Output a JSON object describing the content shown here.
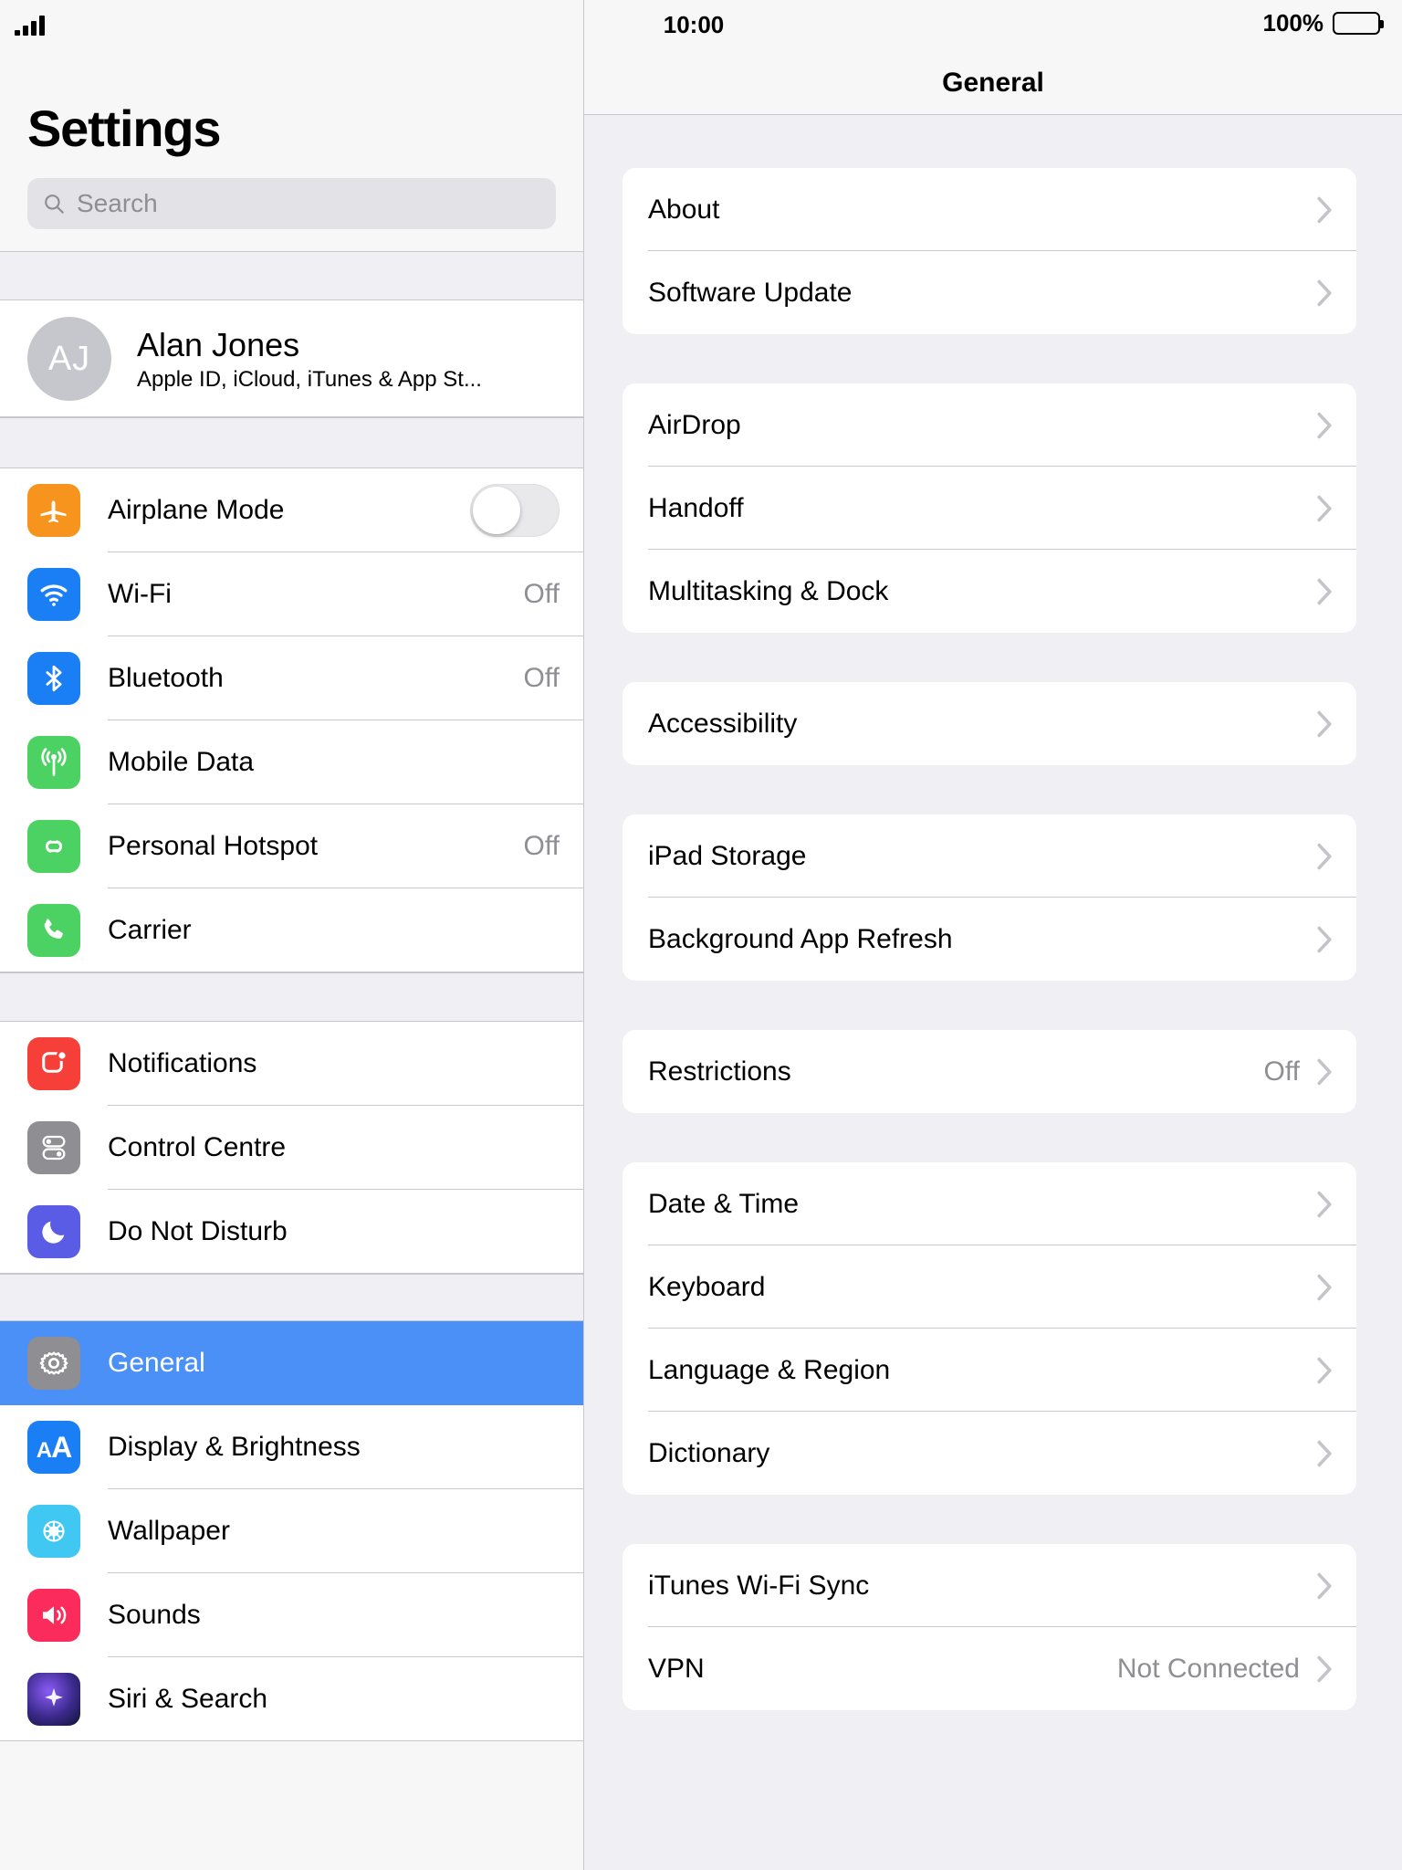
{
  "status_bar": {
    "signal_icon": "cellular-signal-icon",
    "time": "10:00",
    "battery_percent": "100%",
    "battery_icon": "battery-full-icon"
  },
  "sidebar": {
    "title": "Settings",
    "search": {
      "placeholder": "Search",
      "icon": "search-icon"
    },
    "account": {
      "initials": "AJ",
      "name": "Alan Jones",
      "subtitle": "Apple ID, iCloud, iTunes & App St..."
    },
    "group_connectivity": [
      {
        "label": "Airplane Mode",
        "icon": "airplane-icon",
        "color": "#f7941e",
        "control": "toggle",
        "toggle_on": false
      },
      {
        "label": "Wi-Fi",
        "icon": "wifi-icon",
        "color": "#1a7ff5",
        "value": "Off"
      },
      {
        "label": "Bluetooth",
        "icon": "bluetooth-icon",
        "color": "#1a7ff5",
        "value": "Off"
      },
      {
        "label": "Mobile Data",
        "icon": "mobile-data-icon",
        "color": "#4cd263",
        "value": ""
      },
      {
        "label": "Personal Hotspot",
        "icon": "hotspot-icon",
        "color": "#4cd263",
        "value": "Off"
      },
      {
        "label": "Carrier",
        "icon": "phone-icon",
        "color": "#4cd263",
        "value": ""
      }
    ],
    "group_alerts": [
      {
        "label": "Notifications",
        "icon": "notifications-icon",
        "color": "#f63f38"
      },
      {
        "label": "Control Centre",
        "icon": "control-centre-icon",
        "color": "#8e8e93"
      },
      {
        "label": "Do Not Disturb",
        "icon": "do-not-disturb-icon",
        "color": "#5a5ce6"
      }
    ],
    "group_system": [
      {
        "label": "General",
        "icon": "gear-icon",
        "color": "#8e8e93",
        "selected": true
      },
      {
        "label": "Display & Brightness",
        "icon": "display-brightness-icon",
        "color": "#1a7ff5"
      },
      {
        "label": "Wallpaper",
        "icon": "wallpaper-icon",
        "color": "#41c8f2"
      },
      {
        "label": "Sounds",
        "icon": "sounds-icon",
        "color": "#fb2b5b"
      },
      {
        "label": "Siri & Search",
        "icon": "siri-icon",
        "color": "#2b2b4a"
      }
    ],
    "selected_accent": "#4a90f7"
  },
  "detail": {
    "title": "General",
    "groups": [
      {
        "rows": [
          {
            "label": "About",
            "value": "",
            "chevron": true
          },
          {
            "label": "Software Update",
            "value": "",
            "chevron": true
          }
        ]
      },
      {
        "rows": [
          {
            "label": "AirDrop",
            "value": "",
            "chevron": true
          },
          {
            "label": "Handoff",
            "value": "",
            "chevron": true
          },
          {
            "label": "Multitasking & Dock",
            "value": "",
            "chevron": true
          }
        ]
      },
      {
        "rows": [
          {
            "label": "Accessibility",
            "value": "",
            "chevron": true
          }
        ]
      },
      {
        "rows": [
          {
            "label": "iPad Storage",
            "value": "",
            "chevron": true
          },
          {
            "label": "Background App Refresh",
            "value": "",
            "chevron": true
          }
        ]
      },
      {
        "rows": [
          {
            "label": "Restrictions",
            "value": "Off",
            "chevron": true
          }
        ]
      },
      {
        "rows": [
          {
            "label": "Date & Time",
            "value": "",
            "chevron": true
          },
          {
            "label": "Keyboard",
            "value": "",
            "chevron": true
          },
          {
            "label": "Language & Region",
            "value": "",
            "chevron": true
          },
          {
            "label": "Dictionary",
            "value": "",
            "chevron": true
          }
        ]
      },
      {
        "rows": [
          {
            "label": "iTunes Wi-Fi Sync",
            "value": "",
            "chevron": true
          },
          {
            "label": "VPN",
            "value": "Not Connected",
            "chevron": true
          }
        ]
      }
    ]
  }
}
